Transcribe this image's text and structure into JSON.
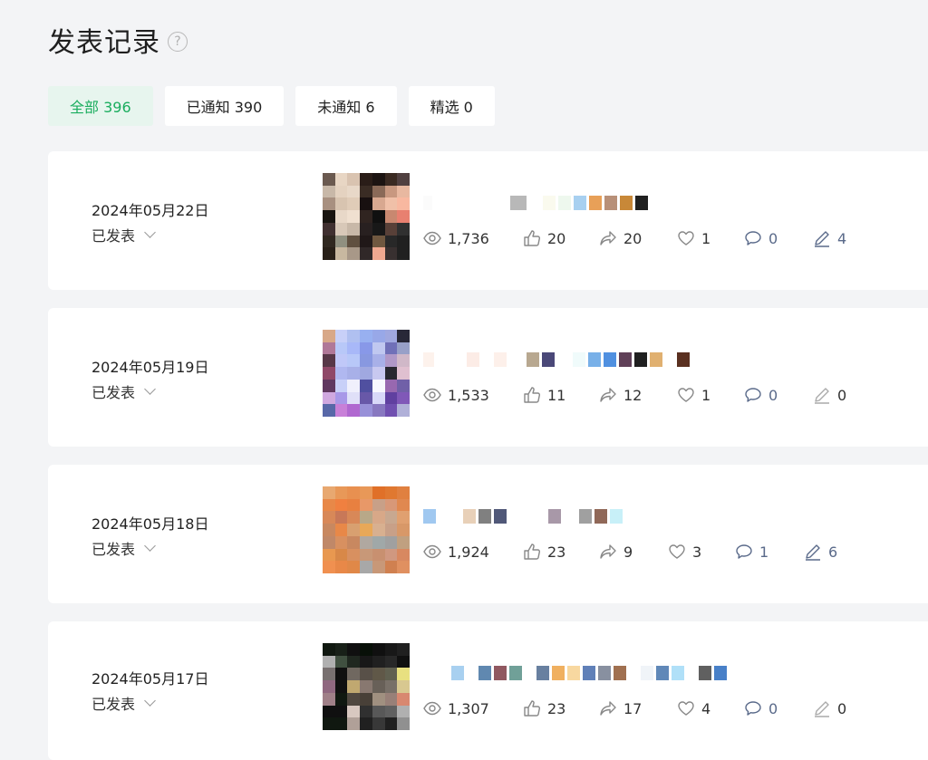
{
  "header": {
    "title": "发表记录",
    "help_icon": "?"
  },
  "tabs": [
    {
      "label": "全部 396",
      "active": true
    },
    {
      "label": "已通知 390",
      "active": false
    },
    {
      "label": "未通知 6",
      "active": false
    },
    {
      "label": "精选 0",
      "active": false
    }
  ],
  "colors": {
    "accent": "#1aad5e",
    "accent_bg": "#e7f5ee",
    "background": "#f3f4f6"
  },
  "records": [
    {
      "date": "2024年05月22日",
      "status": "已发表",
      "stats": {
        "views": "1,736",
        "likes": "20",
        "shares": "20",
        "favorites": "1",
        "comments": "0",
        "edits": "4"
      },
      "thumb_colors": [
        "#6b5a50",
        "#e8d6c4",
        "#d9c3b0",
        "#2a1d18",
        "#1c1412",
        "#3a2a22",
        "#504040",
        "#c8b8a8",
        "#e4d2c0",
        "#e8d8c8",
        "#3a2c24",
        "#8a6a58",
        "#c89880",
        "#e8b8a0",
        "#a89080",
        "#d8c4b0",
        "#e0ccb8",
        "#181010",
        "#d8a890",
        "#f0c0a8",
        "#f8b8a0",
        "#181410",
        "#e8d8c8",
        "#f0e0d0",
        "#302420",
        "#101010",
        "#c88870",
        "#e88070",
        "#403030",
        "#d8c8b8",
        "#c8b8a8",
        "#282020",
        "#181818",
        "#584038",
        "#303030",
        "#302820",
        "#909080",
        "#605040",
        "#201818",
        "#705840",
        "#282828",
        "#202020",
        "#282018",
        "#c8b8a0",
        "#a89888",
        "#302828",
        "#f0a890",
        "#383030",
        "#202020"
      ]
    },
    {
      "date": "2024年05月19日",
      "status": "已发表",
      "stats": {
        "views": "1,533",
        "likes": "11",
        "shares": "12",
        "favorites": "1",
        "comments": "0",
        "edits": "0"
      },
      "thumb_colors": [
        "#d8a888",
        "#c8d0f8",
        "#b0c0f0",
        "#98b0f0",
        "#98a8e8",
        "#a0a8e0",
        "#282838",
        "#b07898",
        "#b8c8f8",
        "#a8b8f8",
        "#8898e8",
        "#c0c8f0",
        "#7070b8",
        "#98a0c8",
        "#583848",
        "#c0c8f8",
        "#b8c8f8",
        "#8898e0",
        "#a8b0e8",
        "#b098c8",
        "#d0b8c8",
        "#904868",
        "#b0b8f0",
        "#a8b0e8",
        "#a0a8e0",
        "#c8c8f0",
        "#282830",
        "#e0c0d0",
        "#603860",
        "#c8d0f8",
        "#f0f0fc",
        "#5050a0",
        "#f8f8ff",
        "#9868b0",
        "#7060a8",
        "#d0a8e0",
        "#a898e8",
        "#e0e0f8",
        "#6858a8",
        "#d8d8f8",
        "#6040a0",
        "#8058b8",
        "#5868a8",
        "#c880d8",
        "#b068d0",
        "#9890d8",
        "#8878c0",
        "#7050b0",
        "#b0b0d8"
      ]
    },
    {
      "date": "2024年05月18日",
      "status": "已发表",
      "stats": {
        "views": "1,924",
        "likes": "23",
        "shares": "9",
        "favorites": "3",
        "comments": "1",
        "edits": "6"
      },
      "thumb_colors": [
        "#e8a870",
        "#e89858",
        "#e89050",
        "#e89858",
        "#e07028",
        "#e07830",
        "#e08040",
        "#e88848",
        "#f08040",
        "#e88040",
        "#e89868",
        "#c8a088",
        "#d89878",
        "#e08850",
        "#d88858",
        "#c87858",
        "#d88858",
        "#b8a888",
        "#d8a888",
        "#c8a890",
        "#e0a070",
        "#c88860",
        "#e88848",
        "#d8a070",
        "#e8a858",
        "#d8b090",
        "#c8a088",
        "#d89868",
        "#c08868",
        "#d89060",
        "#c88860",
        "#b0a8a0",
        "#a0a8a8",
        "#a0a0a0",
        "#c0a080",
        "#e89850",
        "#d88848",
        "#d89060",
        "#c89878",
        "#c89070",
        "#d09880",
        "#d88860",
        "#f09050",
        "#e88848",
        "#e08848",
        "#a8a8a8",
        "#c89878",
        "#d08050",
        "#e09060"
      ]
    },
    {
      "date": "2024年05月17日",
      "status": "已发表",
      "stats": {
        "views": "1,307",
        "likes": "23",
        "shares": "17",
        "favorites": "4",
        "comments": "0",
        "edits": "0"
      },
      "thumb_colors": [
        "#101810",
        "#182018",
        "#101010",
        "#081008",
        "#101010",
        "#181818",
        "#202020",
        "#b0b0b0",
        "#405040",
        "#202820",
        "#181818",
        "#202020",
        "#282828",
        "#101010",
        "#787070",
        "#101010",
        "#706860",
        "#585048",
        "#605848",
        "#606050",
        "#e8e080",
        "#906880",
        "#101010",
        "#c0a870",
        "#887870",
        "#686058",
        "#787068",
        "#d8c890",
        "#a08088",
        "#101810",
        "#504840",
        "#484038",
        "#a09080",
        "#988078",
        "#d88870",
        "#101010",
        "#101010",
        "#d8c8c0",
        "#303030",
        "#585858",
        "#606060",
        "#b0b0b0",
        "#101810",
        "#101810",
        "#b0a098",
        "#202020",
        "#383838",
        "#202020",
        "#909090"
      ]
    }
  ]
}
